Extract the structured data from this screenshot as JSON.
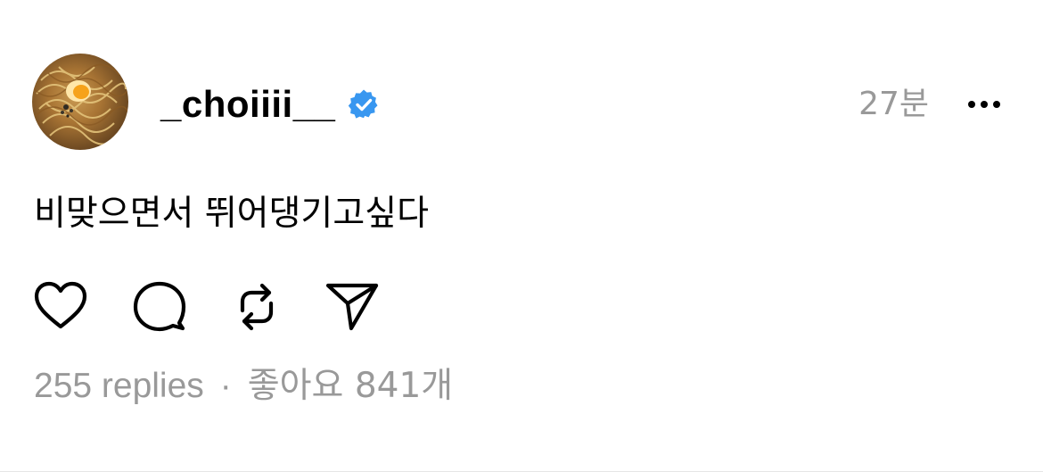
{
  "post": {
    "author": {
      "username": "_choiiii__",
      "verified": true,
      "avatar_icon": "noodle-avatar-image"
    },
    "time_ago": "27분",
    "text": "비맞으면서 뛰어댕기고싶다",
    "actions": [
      {
        "name": "like",
        "icon": "heart-icon"
      },
      {
        "name": "reply",
        "icon": "comment-icon"
      },
      {
        "name": "repost",
        "icon": "repost-icon"
      },
      {
        "name": "share",
        "icon": "send-icon"
      }
    ],
    "stats": {
      "replies": "255 replies",
      "separator": "·",
      "likes": "좋아요 841개"
    }
  },
  "colors": {
    "verified_badge": "#3897f0",
    "muted_text": "#999999",
    "text": "#000000",
    "background": "#ffffff"
  }
}
